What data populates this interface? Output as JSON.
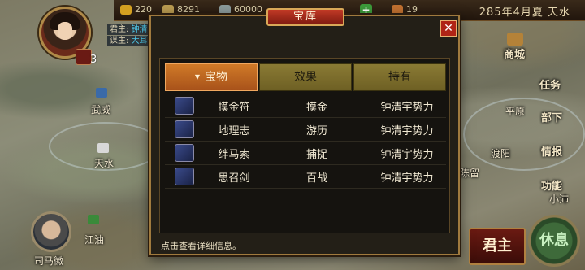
{
  "topbar": {
    "resources": [
      {
        "icon": "gold-coin-icon",
        "value": "220",
        "color": "#d4a020"
      },
      {
        "icon": "grain-sack-icon",
        "value": "8291",
        "color": "#b89a50"
      },
      {
        "icon": "soldiers-icon",
        "value": "60000",
        "color": "#8a9a9a"
      },
      {
        "icon": "jade-icon",
        "value": "19",
        "color": "#c07030"
      }
    ],
    "add_label": "+",
    "date": "285年4月夏 天水"
  },
  "ruler_panel": {
    "lord_label": "君主:",
    "lord_value": "钟清",
    "strategist_label": "谋主:",
    "strategist_value": "大耳",
    "count": "3"
  },
  "map": {
    "cities": [
      {
        "name": "武威"
      },
      {
        "name": "天水"
      },
      {
        "name": "江油"
      },
      {
        "name": "平原"
      },
      {
        "name": "渡阳"
      },
      {
        "name": "陈留"
      },
      {
        "name": "小沛"
      }
    ]
  },
  "right_menu": {
    "shop": "商城",
    "task": "任务",
    "troops": "部下",
    "intel": "情报",
    "function": "功能"
  },
  "advisor": {
    "name": "司马徽"
  },
  "buttons": {
    "lord": "君主",
    "rest": "休息"
  },
  "dialog": {
    "title": "宝库",
    "close_label": "✕",
    "tabs": [
      {
        "label": "宝物",
        "active": true
      },
      {
        "label": "效果",
        "active": false
      },
      {
        "label": "持有",
        "active": false
      }
    ],
    "rows": [
      {
        "icon": "talisman-icon",
        "name": "摸金符",
        "effect": "摸金",
        "owner": "钟清宇势力"
      },
      {
        "icon": "scroll-icon",
        "name": "地理志",
        "effect": "游历",
        "owner": "钟清宇势力"
      },
      {
        "icon": "rope-icon",
        "name": "绊马索",
        "effect": "捕捉",
        "owner": "钟清宇势力"
      },
      {
        "icon": "sword-icon",
        "name": "思召剑",
        "effect": "百战",
        "owner": "钟清宇势力"
      }
    ],
    "hint": "点击查看详细信息。"
  },
  "colors": {
    "accent_red": "#b02416",
    "tab_active": "#d07a28",
    "tab_inactive": "#8a7a34",
    "frame_gold": "#a07a3e",
    "value_cyan": "#4fc7e8"
  }
}
